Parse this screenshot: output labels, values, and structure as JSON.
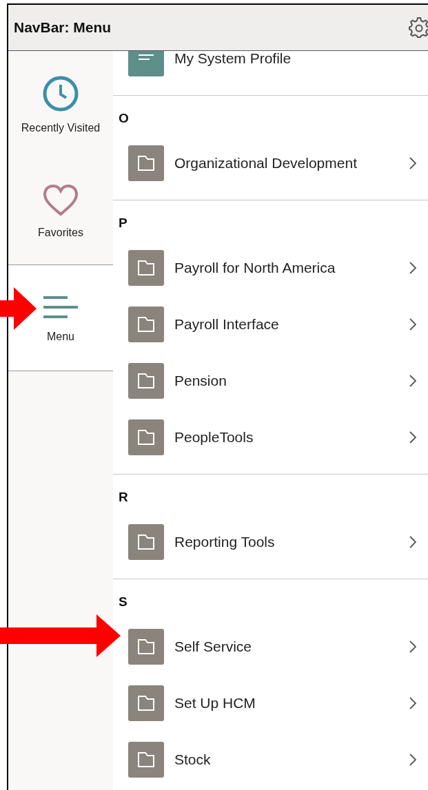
{
  "header": {
    "title": "NavBar: Menu"
  },
  "nav": [
    {
      "kind": "recent",
      "label": "Recently Visited",
      "selected": false
    },
    {
      "kind": "favorites",
      "label": "Favorites",
      "selected": false
    },
    {
      "kind": "menu",
      "label": "Menu",
      "selected": true
    }
  ],
  "sections": [
    {
      "items": [
        {
          "kind": "profile",
          "label": "My System Profile"
        }
      ]
    },
    {
      "letter": "O",
      "items": [
        {
          "kind": "folder",
          "label": "Organizational Development"
        }
      ]
    },
    {
      "letter": "P",
      "items": [
        {
          "kind": "folder",
          "label": "Payroll for North America"
        },
        {
          "kind": "folder",
          "label": "Payroll Interface"
        },
        {
          "kind": "folder",
          "label": "Pension"
        },
        {
          "kind": "folder",
          "label": "PeopleTools"
        }
      ]
    },
    {
      "letter": "R",
      "items": [
        {
          "kind": "folder",
          "label": "Reporting Tools"
        }
      ]
    },
    {
      "letter": "S",
      "items": [
        {
          "kind": "folder",
          "label": "Self Service"
        },
        {
          "kind": "folder",
          "label": "Set Up HCM"
        },
        {
          "kind": "folder",
          "label": "Stock"
        }
      ]
    }
  ]
}
